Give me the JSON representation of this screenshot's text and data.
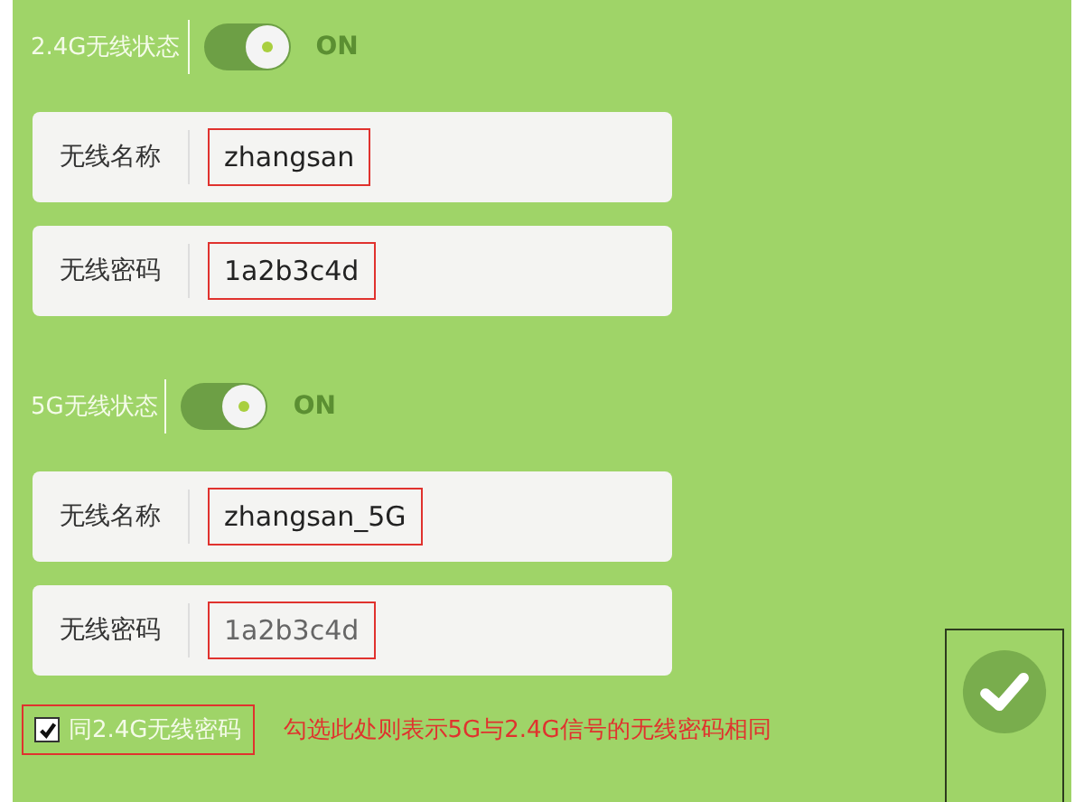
{
  "bands": [
    {
      "status_label": "2.4G无线状态",
      "toggle": {
        "on": true,
        "text": "ON"
      },
      "fields": [
        {
          "label": "无线名称",
          "value": "zhangsan",
          "highlighted": true,
          "muted": false
        },
        {
          "label": "无线密码",
          "value": "1a2b3c4d",
          "highlighted": true,
          "muted": false
        }
      ]
    },
    {
      "status_label": "5G无线状态",
      "toggle": {
        "on": true,
        "text": "ON"
      },
      "fields": [
        {
          "label": "无线名称",
          "value": "zhangsan_5G",
          "highlighted": true,
          "muted": false
        },
        {
          "label": "无线密码",
          "value": "1a2b3c4d",
          "highlighted": true,
          "muted": true
        }
      ]
    }
  ],
  "same_password": {
    "label": "同2.4G无线密码",
    "checked": true,
    "highlighted": true
  },
  "annotation": "勾选此处则表示5G与2.4G信号的无线密码相同",
  "save_button": {
    "highlighted": true
  }
}
